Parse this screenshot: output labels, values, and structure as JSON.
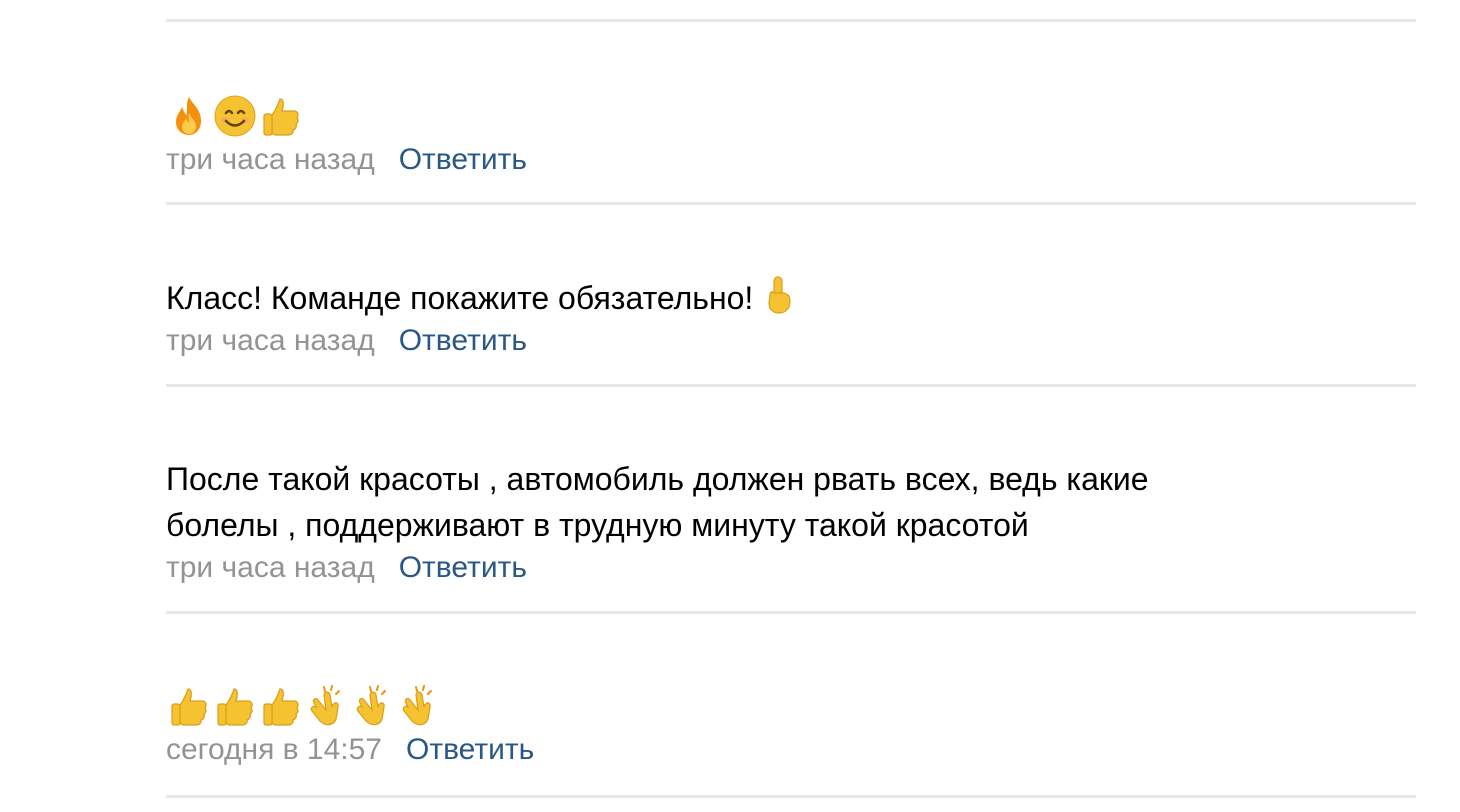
{
  "comments": [
    {
      "emojis": [
        "fire",
        "smiling-face",
        "thumbs-up"
      ],
      "time": "три часа назад",
      "reply_label": "Ответить"
    },
    {
      "text": "Класс! Команде покажите обязательно!",
      "trailing_emoji": "index-pointing-up",
      "time": "три часа назад",
      "reply_label": "Ответить"
    },
    {
      "text_lines": [
        "После такой красоты , автомобиль должен рвать всех, ведь какие",
        "болелы , поддерживают в трудную минуту такой красотой"
      ],
      "time": "три часа назад",
      "reply_label": "Ответить"
    },
    {
      "emojis": [
        "thumbs-up",
        "thumbs-up",
        "thumbs-up",
        "clapping-hands",
        "clapping-hands",
        "clapping-hands"
      ],
      "time": "сегодня в 14:57",
      "reply_label": "Ответить"
    }
  ],
  "colors": {
    "text": "#000000",
    "time": "#939393",
    "link": "#2a5885",
    "divider": "#e7e8ec"
  }
}
